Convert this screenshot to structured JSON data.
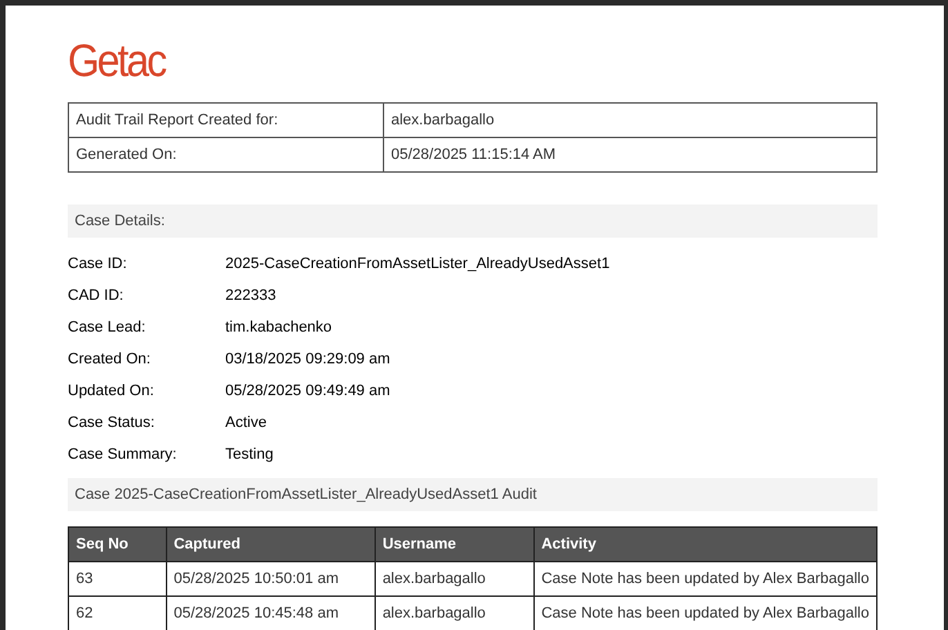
{
  "logo": "Getac",
  "report_info": [
    {
      "label": "Audit Trail Report Created for:",
      "value": "alex.barbagallo"
    },
    {
      "label": "Generated On:",
      "value": "05/28/2025 11:15:14 AM"
    }
  ],
  "case_details": {
    "heading": "Case Details:",
    "fields": [
      {
        "label": "Case ID:",
        "value": "2025-CaseCreationFromAssetLister_AlreadyUsedAsset1"
      },
      {
        "label": "CAD ID:",
        "value": "222333"
      },
      {
        "label": "Case Lead:",
        "value": "tim.kabachenko"
      },
      {
        "label": "Created On:",
        "value": "03/18/2025 09:29:09 am"
      },
      {
        "label": "Updated On:",
        "value": "05/28/2025 09:49:49 am"
      },
      {
        "label": "Case Status:",
        "value": "Active"
      },
      {
        "label": "Case Summary:",
        "value": "Testing"
      }
    ]
  },
  "audit": {
    "heading": "Case 2025-CaseCreationFromAssetLister_AlreadyUsedAsset1 Audit",
    "columns": [
      "Seq No",
      "Captured",
      "Username",
      "Activity"
    ],
    "rows": [
      [
        "63",
        "05/28/2025 10:50:01 am",
        "alex.barbagallo",
        "Case Note has been updated by Alex Barbagallo"
      ],
      [
        "62",
        "05/28/2025 10:45:48 am",
        "alex.barbagallo",
        "Case Note has been updated by Alex Barbagallo"
      ]
    ]
  }
}
